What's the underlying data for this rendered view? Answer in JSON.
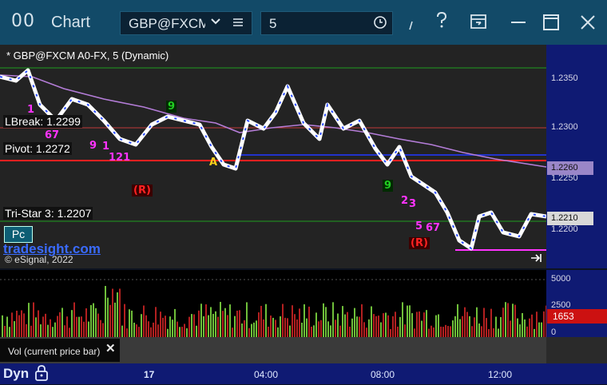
{
  "window": {
    "logo_glyph": "00",
    "title": "Chart",
    "symbol": "GBP@FXCM",
    "interval": "5",
    "icons": [
      "chevron-down-icon",
      "menu-icon",
      "clock-icon",
      "draw-icon",
      "help-icon",
      "layout-icon",
      "minimize-icon",
      "maximize-icon",
      "close-icon"
    ]
  },
  "chart": {
    "title": "* GBP@FXCM A0-FX, 5 (Dynamic)",
    "price_ticks": [
      "1.2350",
      "1.2300",
      "1.2250",
      "1.2200"
    ],
    "price_tags": [
      {
        "value": "1.2260",
        "color": "#9a86c8"
      },
      {
        "value": "1.2210",
        "color": "#d8d8d8"
      }
    ],
    "labels": {
      "lbreak": "LBreak: 1.2299",
      "pivot": "Pivot: 1.2272",
      "tristar": "Tri-Star 3: 1.2207"
    },
    "pc_button": "Pc",
    "brand_link": "tradesight.com",
    "copyright": "© eSignal, 2022",
    "markers": [
      {
        "text": "1",
        "color": "#ff33ff"
      },
      {
        "text": "67",
        "color": "#ff33ff"
      },
      {
        "text": "9",
        "color": "#ff33ff"
      },
      {
        "text": "1",
        "color": "#ff33ff"
      },
      {
        "text": "121",
        "color": "#ff33ff"
      },
      {
        "text": "(R)",
        "color": "#ff2222"
      },
      {
        "text": "9",
        "color": "#22cc22"
      },
      {
        "text": "A",
        "color": "#ffd21a"
      },
      {
        "text": "9",
        "color": "#22cc22"
      },
      {
        "text": "2",
        "color": "#ff33ff"
      },
      {
        "text": "3",
        "color": "#ff33ff"
      },
      {
        "text": "5",
        "color": "#ff33ff"
      },
      {
        "text": "67",
        "color": "#ff33ff"
      },
      {
        "text": "(R)",
        "color": "#ff2222"
      }
    ]
  },
  "volume": {
    "ticks": [
      "5000",
      "2500",
      "0"
    ],
    "current": "1653",
    "label": "Vol (current price bar)"
  },
  "timeaxis": {
    "badge": "Dyn",
    "labels": [
      "17",
      "04:00",
      "08:00",
      "12:00"
    ]
  }
}
